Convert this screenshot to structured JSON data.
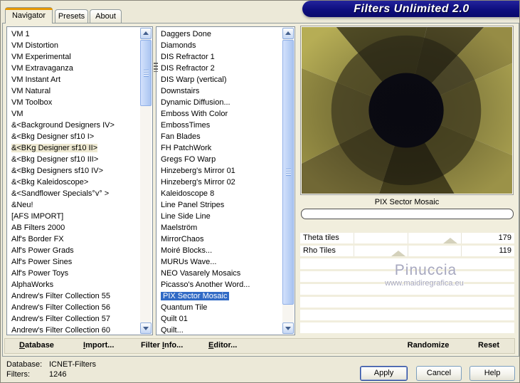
{
  "title": "Filters Unlimited 2.0",
  "tabs": [
    {
      "label": "Navigator",
      "active": true
    },
    {
      "label": "Presets",
      "active": false
    },
    {
      "label": "About",
      "active": false
    }
  ],
  "left_list": {
    "items": [
      "VM 1",
      "VM Distortion",
      "VM Experimental",
      "VM Extravaganza",
      "VM Instant Art",
      "VM Natural",
      "VM Toolbox",
      "VM",
      "&<Background Designers IV>",
      "&<Bkg Designer sf10 I>",
      "&<BKg Designer sf10 II>",
      "&<Bkg Designer sf10 III>",
      "&<Bkg Designers sf10 IV>",
      "&<Bkg Kaleidoscope>",
      "&<Sandflower Specials°v° >",
      "&Neu!",
      "[AFS IMPORT]",
      "AB Filters 2000",
      "Alf's Border FX",
      "Alf's Power Grads",
      "Alf's Power Sines",
      "Alf's Power Toys",
      "AlphaWorks",
      "Andrew's Filter Collection 55",
      "Andrew's Filter Collection 56",
      "Andrew's Filter Collection 57",
      "Andrew's Filter Collection 60"
    ],
    "selected_index": 10
  },
  "filter_list": {
    "items": [
      "Daggers Done",
      "Diamonds",
      "DIS Refractor 1",
      "DIS Refractor 2",
      "DIS Warp (vertical)",
      "Downstairs",
      "Dynamic Diffusion...",
      "Emboss With Color",
      "EmbossTimes",
      "Fan Blades",
      "FH PatchWork",
      "Gregs FO Warp",
      "Hinzeberg's Mirror 01",
      "Hinzeberg's Mirror 02",
      "Kaleidoscope 8",
      "Line Panel Stripes",
      "Line Side Line",
      "Maelström",
      "MirrorChaos",
      "Moiré Blocks...",
      "MURUs Wave...",
      "NEO Vasarely Mosaics",
      "Picasso's Another Word...",
      "PIX Sector Mosaic",
      "Quantum Tile",
      "Quilt 01",
      "Quilt..."
    ],
    "selected_index": 23
  },
  "preview": {
    "caption": "PIX Sector Mosaic"
  },
  "sliders": {
    "rows": [
      {
        "label": "Theta tiles",
        "value": "179",
        "pos": 0.7
      },
      {
        "label": "Rho Tiles",
        "value": "119",
        "pos": 0.46
      }
    ],
    "empty_rows": 6,
    "tick_positions": [
      0.25,
      0.5,
      0.75
    ]
  },
  "watermark": {
    "line1": "Pinuccia",
    "line2": "www.maidiregrafica.eu"
  },
  "menu": {
    "items": [
      {
        "label": "Database",
        "mnemonic": 0
      },
      {
        "label": "Import...",
        "mnemonic": 0
      },
      {
        "label": "Filter Info...",
        "mnemonic": 7
      },
      {
        "label": "Editor...",
        "mnemonic": 0
      }
    ]
  },
  "actions": {
    "randomize": "Randomize",
    "reset": "Reset"
  },
  "status": {
    "database_label": "Database:",
    "database_value": "ICNET-Filters",
    "filters_label": "Filters:",
    "filters_value": "1246"
  },
  "buttons": {
    "apply": "Apply",
    "cancel": "Cancel",
    "help": "Help"
  },
  "colors": {
    "dialog_bg": "#ece9d8",
    "banner": "#0e0e7e",
    "selection_blue": "#316ac5",
    "left_selection": "#eee9d2",
    "tab_accent_orange": "#e59700"
  }
}
